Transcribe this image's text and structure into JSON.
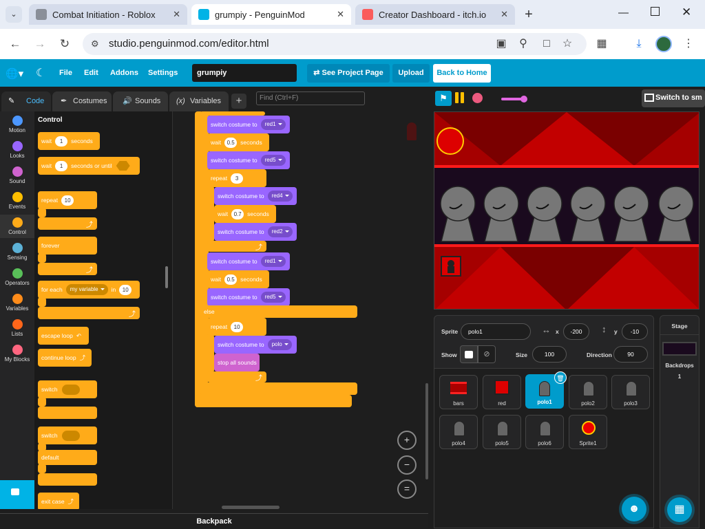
{
  "browser": {
    "tabs": [
      {
        "title": "Combat Initiation - Roblox",
        "active": false
      },
      {
        "title": "grumpiy - PenguinMod",
        "active": true
      },
      {
        "title": "Creator Dashboard - itch.io",
        "active": false
      }
    ],
    "url": "studio.penguinmod.com/editor.html"
  },
  "menu": {
    "file": "File",
    "edit": "Edit",
    "addons": "Addons",
    "settings": "Settings",
    "project_title": "grumpiy",
    "see_project_page": "See Project Page",
    "upload": "Upload",
    "back_to_home": "Back to Home"
  },
  "editor_tabs": {
    "code": "Code",
    "costumes": "Costumes",
    "sounds": "Sounds",
    "variables": "Variables",
    "find_placeholder": "Find (Ctrl+F)"
  },
  "categories": [
    {
      "label": "Motion",
      "color": "#4c97ff"
    },
    {
      "label": "Looks",
      "color": "#9966ff"
    },
    {
      "label": "Sound",
      "color": "#cf63cf"
    },
    {
      "label": "Events",
      "color": "#ffbf00"
    },
    {
      "label": "Control",
      "color": "#ffab19"
    },
    {
      "label": "Sensing",
      "color": "#5cb1d6"
    },
    {
      "label": "Operators",
      "color": "#59c059"
    },
    {
      "label": "Variables",
      "color": "#ff8c1a"
    },
    {
      "label": "Lists",
      "color": "#ff661a"
    },
    {
      "label": "My Blocks",
      "color": "#ff6680"
    }
  ],
  "palette": {
    "heading": "Control",
    "wait": "wait",
    "wait_value": "1",
    "seconds": "seconds",
    "wait_until": "wait",
    "wait_until_value": "1",
    "seconds_or_until": "seconds or until",
    "repeat": "repeat",
    "repeat_value": "10",
    "forever": "forever",
    "for_each": "for each",
    "my_variable": "my variable",
    "in": "in",
    "for_each_value": "10",
    "escape_loop": "escape loop",
    "continue_loop": "continue loop",
    "switch": "switch",
    "switch2": "switch",
    "default": "default",
    "exit_case": "exit case"
  },
  "script": {
    "switch_costume": "switch costume to",
    "wait": "wait",
    "seconds": "seconds",
    "repeat": "repeat",
    "else": "else",
    "stop_all_sounds": "stop all sounds",
    "red1": "red1",
    "red5": "red5",
    "red4": "red4",
    "red2": "red2",
    "polo": "polo",
    "v05": "0.5",
    "v07": "0.7",
    "v3": "3",
    "v10": "10"
  },
  "backpack": "Backpack",
  "stage_header": {
    "switch_label": "Switch to sm"
  },
  "sprite_info": {
    "sprite_label": "Sprite",
    "sprite_name": "polo1",
    "x_label": "x",
    "x_value": "-200",
    "y_label": "y",
    "y_value": "-10",
    "show_label": "Show",
    "size_label": "Size",
    "size_value": "100",
    "direction_label": "Direction",
    "direction_value": "90"
  },
  "sprites": [
    {
      "name": "bars",
      "selected": false
    },
    {
      "name": "red",
      "selected": false
    },
    {
      "name": "polo1",
      "selected": true
    },
    {
      "name": "polo2",
      "selected": false
    },
    {
      "name": "polo3",
      "selected": false
    },
    {
      "name": "polo4",
      "selected": false
    },
    {
      "name": "polo5",
      "selected": false
    },
    {
      "name": "polo6",
      "selected": false
    },
    {
      "name": "Sprite1",
      "selected": false
    }
  ],
  "stage_pane": {
    "title": "Stage",
    "backdrops_label": "Backdrops",
    "backdrops_count": "1"
  }
}
